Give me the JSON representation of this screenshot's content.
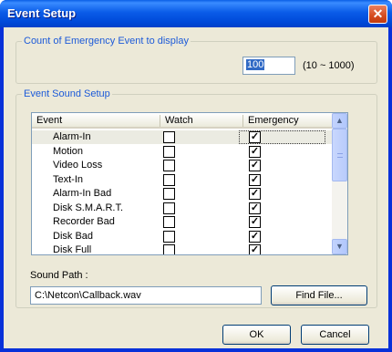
{
  "window": {
    "title": "Event Setup",
    "close_glyph": "✕"
  },
  "count_group": {
    "legend": "Count of Emergency Event to display",
    "value": "100",
    "range": "(10 ~ 1000)"
  },
  "sound_group": {
    "legend": "Event Sound Setup",
    "columns": [
      "Event",
      "Watch",
      "Emergency"
    ],
    "rows": [
      {
        "event": "Alarm-In",
        "watch": false,
        "emergency": true
      },
      {
        "event": "Motion",
        "watch": false,
        "emergency": true
      },
      {
        "event": "Video Loss",
        "watch": false,
        "emergency": true
      },
      {
        "event": "Text-In",
        "watch": false,
        "emergency": true
      },
      {
        "event": "Alarm-In Bad",
        "watch": false,
        "emergency": true
      },
      {
        "event": "Disk S.M.A.R.T.",
        "watch": false,
        "emergency": true
      },
      {
        "event": "Recorder Bad",
        "watch": false,
        "emergency": true
      },
      {
        "event": "Disk Bad",
        "watch": false,
        "emergency": true
      },
      {
        "event": "Disk Full",
        "watch": false,
        "emergency": true
      }
    ],
    "scroll_up": "▲",
    "scroll_down": "▼",
    "sound_path_label": "Sound Path :",
    "sound_path_value": "C:\\Netcon\\Callback.wav",
    "find_file_label": "Find File..."
  },
  "buttons": {
    "ok": "OK",
    "cancel": "Cancel"
  },
  "check_glyph": "✓"
}
